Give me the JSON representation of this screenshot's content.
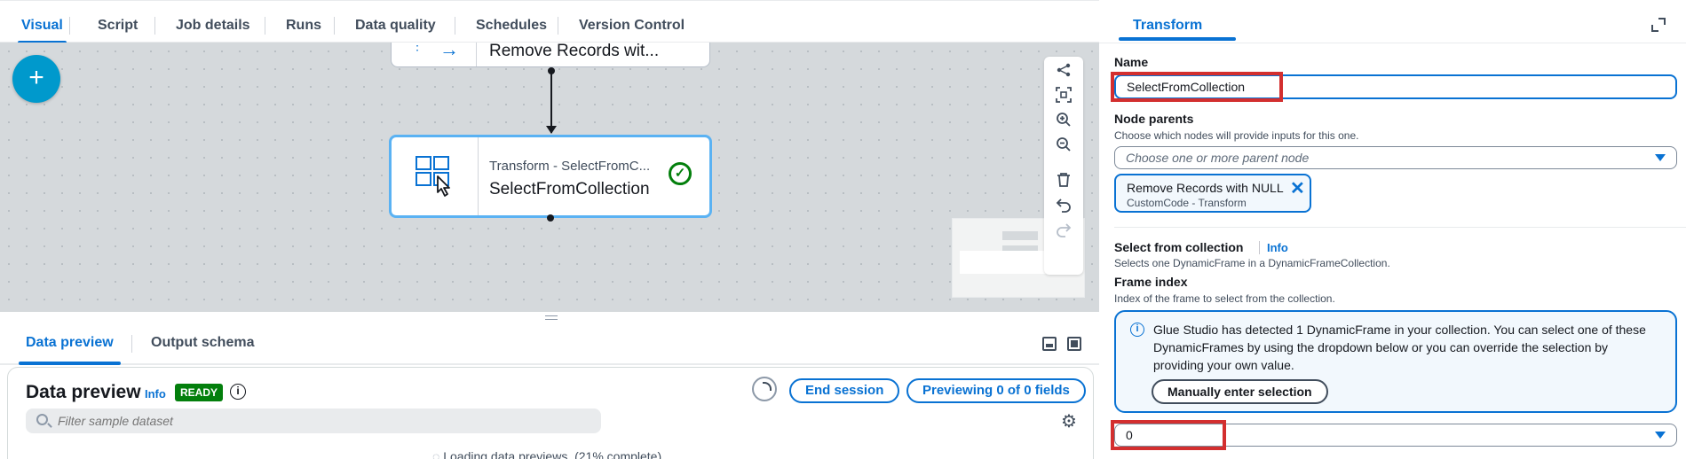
{
  "top_tabs": [
    {
      "label": "Visual",
      "active": true
    },
    {
      "label": "Script"
    },
    {
      "label": "Job details"
    },
    {
      "label": "Runs"
    },
    {
      "label": "Data quality"
    },
    {
      "label": "Schedules"
    },
    {
      "label": "Version Control"
    }
  ],
  "canvas": {
    "add_label": "+",
    "node_top": {
      "title": "Remove Records wit..."
    },
    "node_main": {
      "subtitle": "Transform - SelectFromC...",
      "title": "SelectFromCollection",
      "status": "✓"
    },
    "toolbar_icons": [
      "layout-icon",
      "fit-view-icon",
      "zoom-in-icon",
      "zoom-out-icon",
      "delete-icon",
      "undo-icon",
      "redo-icon"
    ]
  },
  "bottom": {
    "tabs": [
      {
        "label": "Data preview",
        "active": true
      },
      {
        "label": "Output schema"
      }
    ],
    "preview": {
      "title": "Data preview",
      "info": "Info",
      "badge": "READY",
      "end_session": "End session",
      "previewing": "Previewing 0 of 0 fields",
      "filter_placeholder": "Filter sample dataset",
      "loading": "Loading data previews. (21% complete)"
    }
  },
  "panel": {
    "tab": "Transform",
    "name_label": "Name",
    "name_value": "SelectFromCollection",
    "parents_label": "Node parents",
    "parents_desc": "Choose which nodes will provide inputs for this one.",
    "parents_placeholder": "Choose one or more parent node",
    "token": {
      "title": "Remove Records with NULL",
      "subtitle": "CustomCode - Transform"
    },
    "section_title": "Select from collection",
    "section_info": "Info",
    "section_desc": "Selects one DynamicFrame in a DynamicFrameCollection.",
    "frame_label": "Frame index",
    "frame_desc": "Index of the frame to select from the collection.",
    "alert_text": "Glue Studio has detected 1 DynamicFrame in your collection. You can select one of these DynamicFrames by using the dropdown below or you can override the selection by providing your own value.",
    "alert_button": "Manually enter selection",
    "frame_value": "0"
  },
  "colors": {
    "accent": "#0972d3",
    "success": "#037f0c",
    "highlight": "#d32f2f",
    "add_button": "#0099cc"
  }
}
